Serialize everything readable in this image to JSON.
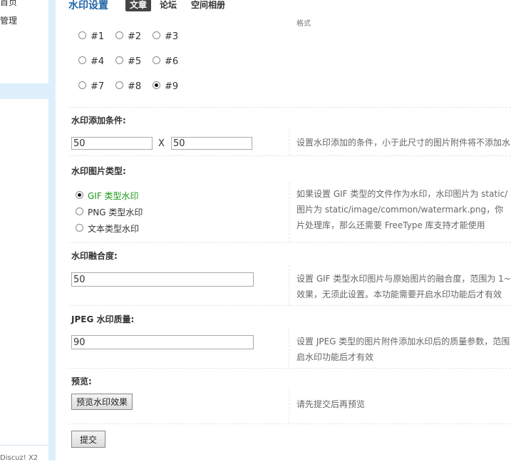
{
  "sidebar": {
    "items": [
      {
        "label": "首页"
      },
      {
        "label": "管理"
      }
    ],
    "footer": "Discuz! X2"
  },
  "header": {
    "title": "水印设置",
    "tabs": [
      {
        "label": "文章",
        "active": true
      },
      {
        "label": "论坛",
        "active": false
      },
      {
        "label": "空间相册",
        "active": false
      }
    ]
  },
  "position": {
    "tip": "格式",
    "options": [
      "#1",
      "#2",
      "#3",
      "#4",
      "#5",
      "#6",
      "#7",
      "#8",
      "#9"
    ],
    "selected": "#9"
  },
  "condition": {
    "label": "水印添加条件:",
    "width": "50",
    "height": "50",
    "separator": "X",
    "tip": "设置水印添加的条件，小于此尺寸的图片附件将不添加水"
  },
  "image_type": {
    "label": "水印图片类型:",
    "options": [
      "GIF 类型水印",
      "PNG 类型水印",
      "文本类型水印"
    ],
    "selected": "GIF 类型水印",
    "tip": [
      "如果设置 GIF 类型的文件作为水印，水印图片为 static/",
      "图片为 static/image/common/watermark.png，你",
      "片处理库，那么还需要 FreeType 库支持才能使用"
    ]
  },
  "blend": {
    "label": "水印融合度:",
    "value": "50",
    "tip": [
      "设置 GIF 类型水印图片与原始图片的融合度，范围为 1~",
      "效果，无须此设置。本功能需要开启水印功能后才有效"
    ]
  },
  "jpeg_quality": {
    "label": "JPEG 水印质量:",
    "value": "90",
    "tip": [
      "设置 JPEG 类型的图片附件添加水印后的质量参数，范围",
      "启水印功能后才有效"
    ]
  },
  "preview": {
    "label": "预览:",
    "button": "预览水印效果",
    "tip": "请先提交后再预览"
  },
  "submit": {
    "button": "提交"
  }
}
